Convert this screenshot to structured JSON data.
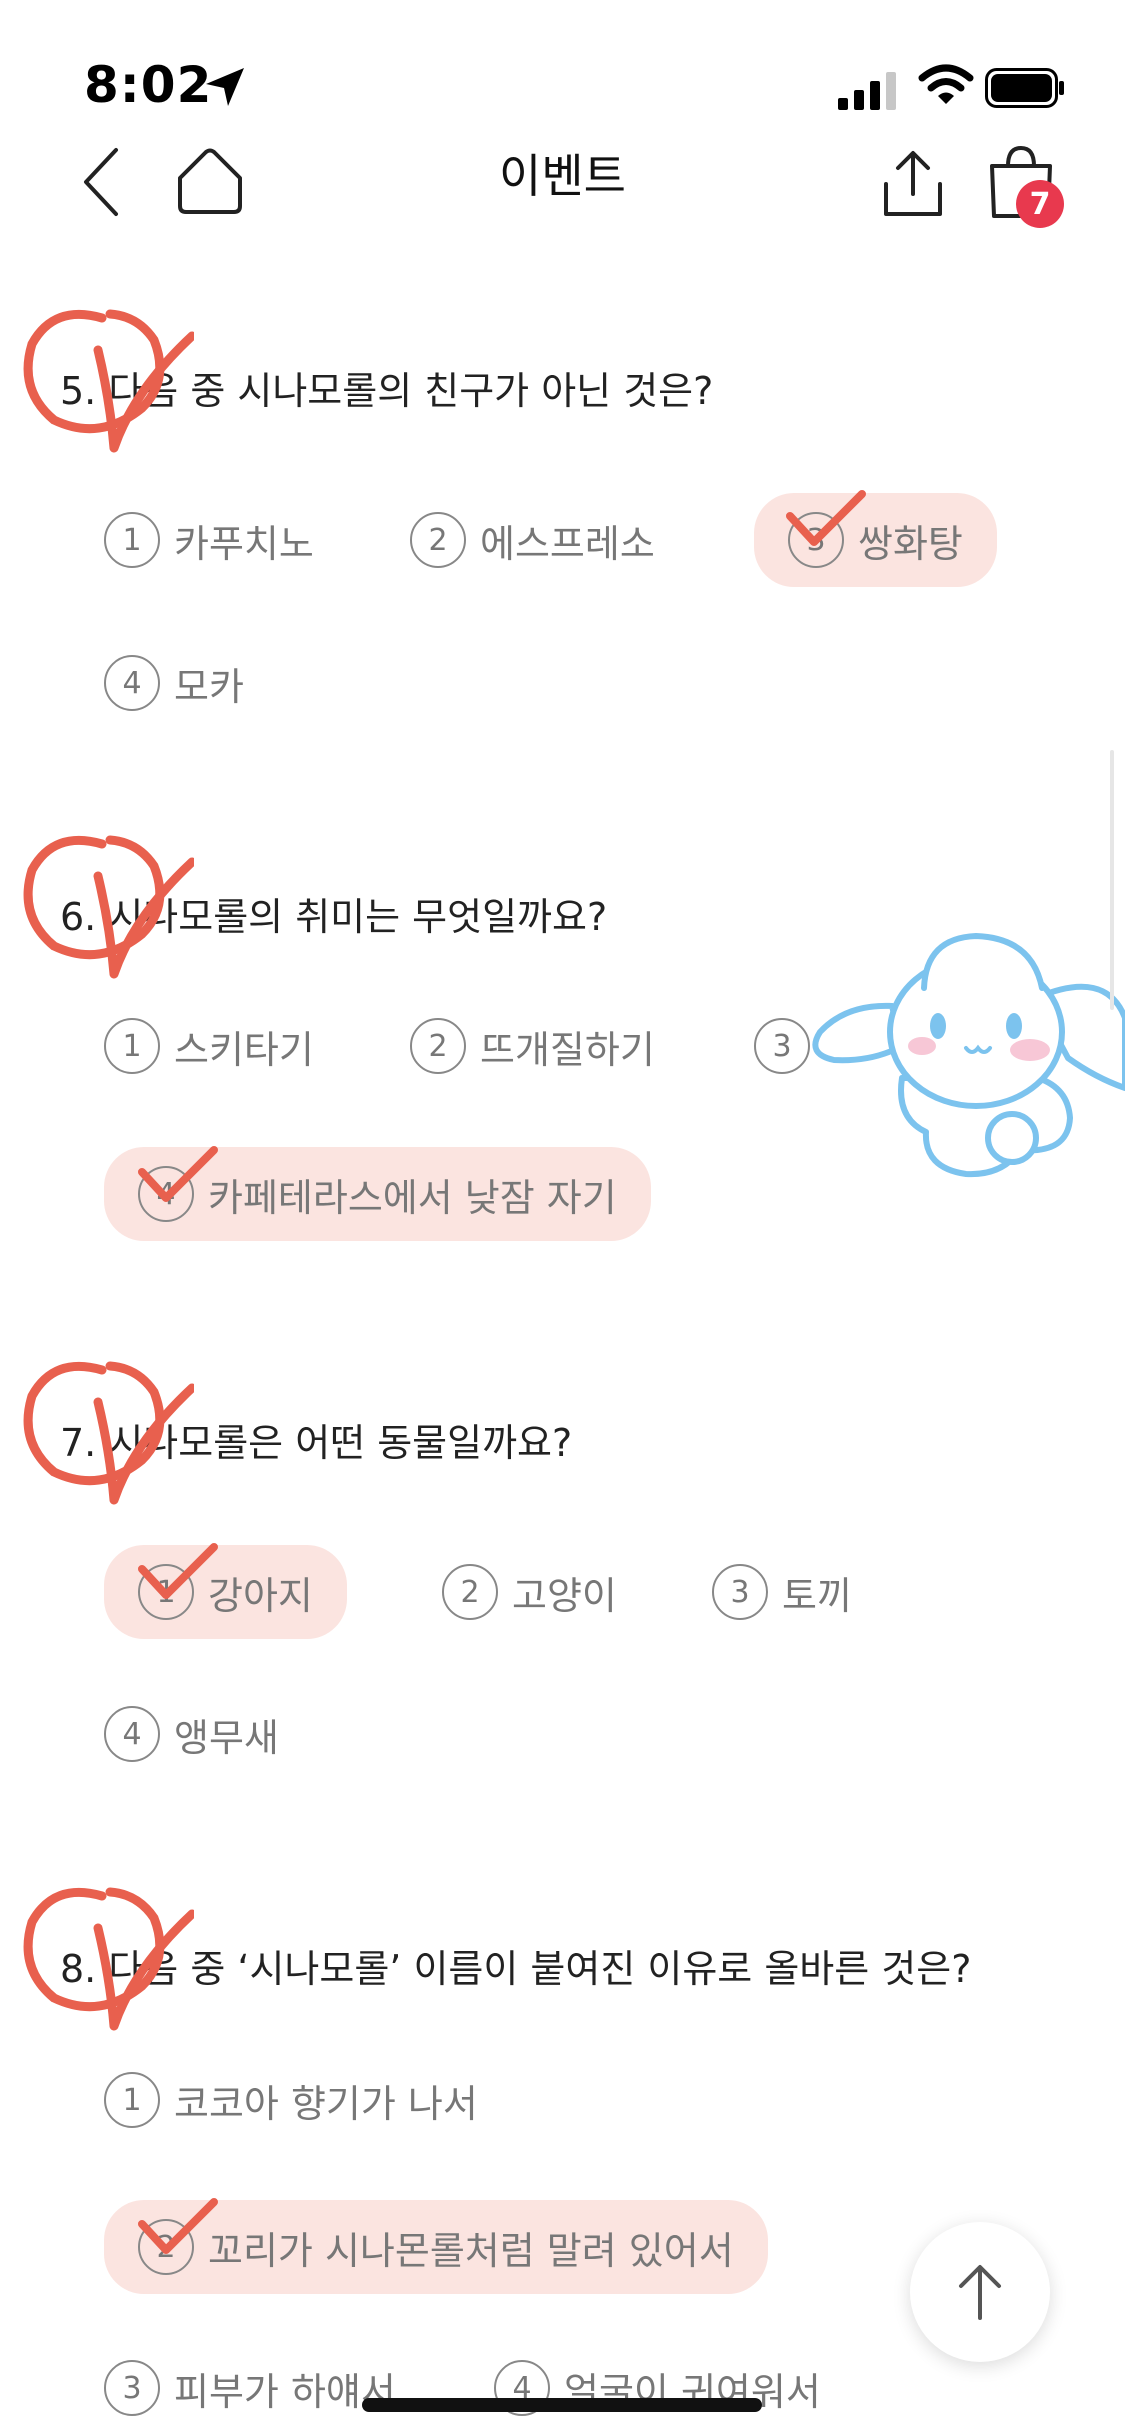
{
  "status_bar": {
    "time": "8:02"
  },
  "nav": {
    "title": "이벤트",
    "cart_count": "7"
  },
  "questions": [
    {
      "label": "5. 다음 중 시나모롤의 친구가 아닌 것은?",
      "options": [
        {
          "num": "1",
          "text": "카푸치노"
        },
        {
          "num": "2",
          "text": "에스프레소"
        },
        {
          "num": "3",
          "text": "쌍화탕",
          "selected": true
        },
        {
          "num": "4",
          "text": "모카"
        }
      ]
    },
    {
      "label": "6. 시나모롤의 취미는 무엇일까요?",
      "options": [
        {
          "num": "1",
          "text": "스키타기"
        },
        {
          "num": "2",
          "text": "뜨개질하기"
        },
        {
          "num": "3",
          "text": ""
        },
        {
          "num": "4",
          "text": "카페테라스에서 낮잠 자기",
          "selected": true
        }
      ]
    },
    {
      "label": "7. 시나모롤은 어떤 동물일까요?",
      "options": [
        {
          "num": "1",
          "text": "강아지",
          "selected": true
        },
        {
          "num": "2",
          "text": "고양이"
        },
        {
          "num": "3",
          "text": "토끼"
        },
        {
          "num": "4",
          "text": "앵무새"
        }
      ]
    },
    {
      "label": "8. 다음 중 ‘시나모롤’ 이름이 붙여진 이유로 올바른 것은?",
      "options": [
        {
          "num": "1",
          "text": "코코아 향기가 나서"
        },
        {
          "num": "2",
          "text": "꼬리가 시나몬롤처럼 말려 있어서",
          "selected": true
        },
        {
          "num": "3",
          "text": "피부가 하얘서"
        },
        {
          "num": "4",
          "text": "얼굴이 귀여워서"
        }
      ]
    }
  ],
  "colors": {
    "accent_red": "#e8394e",
    "mark_red": "#e8604e",
    "selected_bg": "#fbe4e0",
    "character_blue": "#7cc3ee"
  },
  "icons": [
    "back-icon",
    "home-icon",
    "share-icon",
    "shopping-bag-icon",
    "arrow-up-icon"
  ]
}
